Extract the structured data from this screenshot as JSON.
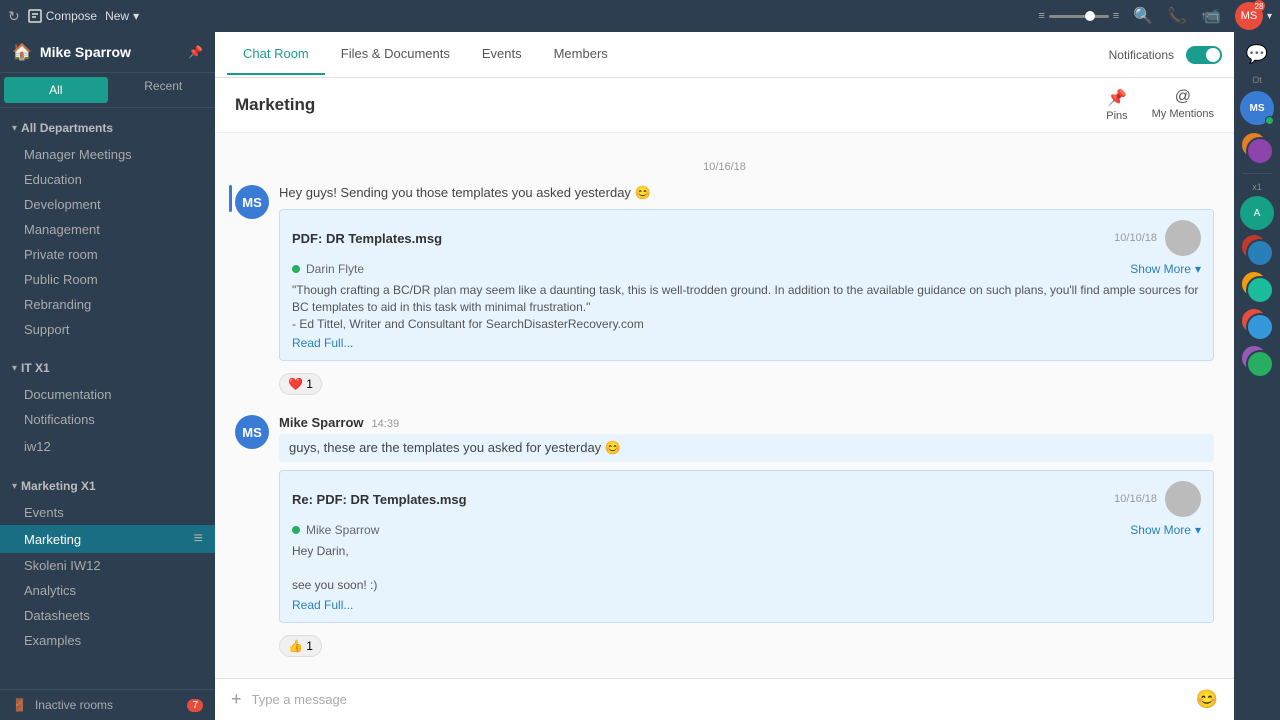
{
  "topbar": {
    "refresh_icon": "↻",
    "compose_label": "Compose",
    "new_label": "New",
    "menu_icon": "≡",
    "search_icon": "🔍",
    "phone_icon": "📞",
    "chat_icon": "💬",
    "profile_icon": "👤"
  },
  "sidebar": {
    "header_icon": "🏠",
    "header_title": "Mike Sparrow",
    "pin_icon": "📌",
    "tabs": [
      {
        "label": "All",
        "active": true
      },
      {
        "label": "Recent",
        "active": false
      }
    ],
    "groups": [
      {
        "name": "All Departments",
        "expanded": true,
        "items": [
          {
            "label": "Manager Meetings"
          },
          {
            "label": "Education"
          },
          {
            "label": "Development"
          },
          {
            "label": "Management"
          },
          {
            "label": "Private room"
          },
          {
            "label": "Public Room"
          },
          {
            "label": "Rebranding"
          },
          {
            "label": "Support"
          }
        ]
      },
      {
        "name": "IT X1",
        "expanded": true,
        "items": [
          {
            "label": "Documentation"
          },
          {
            "label": "Notifications"
          },
          {
            "label": "iw12"
          }
        ]
      },
      {
        "name": "Marketing X1",
        "expanded": true,
        "items": [
          {
            "label": "Events"
          },
          {
            "label": "Marketing",
            "active": true
          },
          {
            "label": "Skoleni IW12"
          },
          {
            "label": "Analytics"
          },
          {
            "label": "Datasheets"
          },
          {
            "label": "Examples"
          }
        ]
      }
    ],
    "footer_label": "Inactive rooms",
    "footer_badge": "7"
  },
  "tabs": [
    {
      "label": "Chat Room",
      "active": true
    },
    {
      "label": "Files & Documents",
      "active": false
    },
    {
      "label": "Events",
      "active": false
    },
    {
      "label": "Members",
      "active": false
    }
  ],
  "notifications": {
    "label": "Notifications",
    "enabled": true
  },
  "chat_header": {
    "title": "Marketing",
    "actions": [
      {
        "label": "Pins",
        "icon": "📌"
      },
      {
        "label": "My Mentions",
        "icon": "@"
      }
    ]
  },
  "messages": [
    {
      "date": "10/16/18",
      "avatar_initials": "MS",
      "avatar_color": "#3a7bd5",
      "author": "",
      "time": "",
      "text": "Hey guys! Sending you those templates you asked yesterday 😊",
      "quoted": {
        "title": "PDF: DR Templates.msg",
        "date": "10/10/18",
        "author": "Darin Flyte",
        "body": "\"Though crafting a BC/DR plan may seem like a daunting task, this is well-trodden ground. In addition to the available guidance on such plans, you'll find ample sources for BC templates to aid in this task with minimal frustration.\"\n- Ed Tittel, Writer and Consultant for SearchDisasterRecovery.com",
        "read_full": "Read Full...",
        "show_more": "Show More"
      },
      "reaction": "❤️ 1"
    },
    {
      "date": "",
      "avatar_initials": "MS",
      "avatar_color": "#3a7bd5",
      "author": "Mike Sparrow",
      "time": "14:39",
      "text": "guys, these are the templates you asked for yesterday 😊",
      "quoted": {
        "title": "Re: PDF: DR Templates.msg",
        "date": "10/16/18",
        "author": "Mike Sparrow",
        "body": "Hey Darin,\n\nsee you soon! :)",
        "read_full": "Read Full...",
        "show_more": "Show More"
      },
      "reaction": "👍 1"
    }
  ],
  "chat_input": {
    "placeholder": "Type a message",
    "add_icon": "+",
    "emoji_icon": "😊"
  },
  "right_sidebar": {
    "chat_icon": "💬",
    "section_ot": "Ot",
    "section_x1": "x1"
  }
}
